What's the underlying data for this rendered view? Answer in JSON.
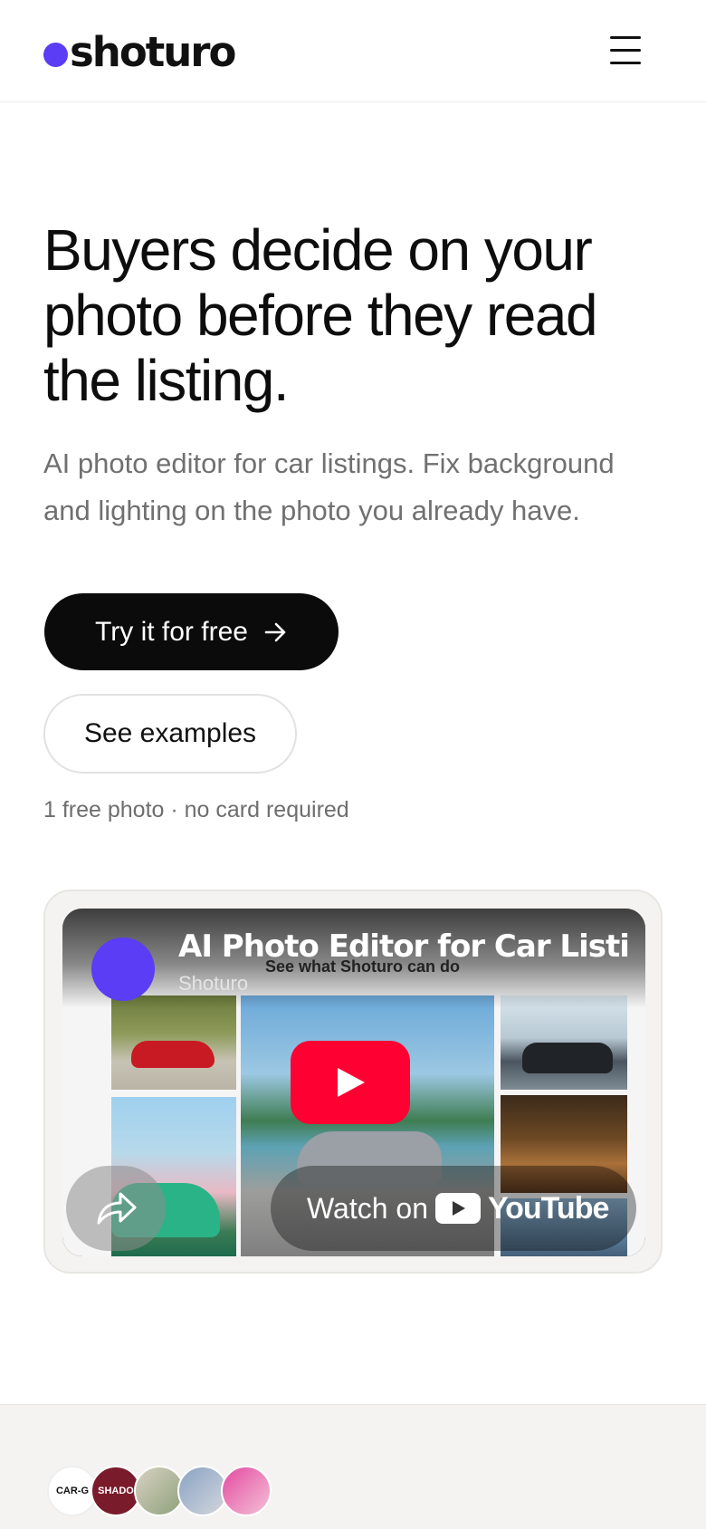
{
  "header": {
    "logo_text": "shoturo",
    "brand_color": "#5a3df5",
    "menu_icon": "hamburger-menu-icon"
  },
  "hero": {
    "title": "Buyers decide on your photo before they read the listing.",
    "subtitle": "AI photo editor for car listings. Fix background and lighting on the photo you already have.",
    "primary_button": "Try it for free",
    "secondary_button": "See examples",
    "note": "1 free photo · no card required"
  },
  "video": {
    "title": "AI Photo Editor for Car Listings",
    "channel": "Shoturo",
    "overlay_text": "See what Shoturo can do",
    "watch_on": "Watch on",
    "youtube_word": "YouTube",
    "play_color": "#ff0033"
  },
  "customers": {
    "avatars": [
      {
        "label": "CAR-G"
      },
      {
        "label": "SHADO"
      },
      {
        "label": ""
      },
      {
        "label": ""
      },
      {
        "label": ""
      }
    ]
  }
}
